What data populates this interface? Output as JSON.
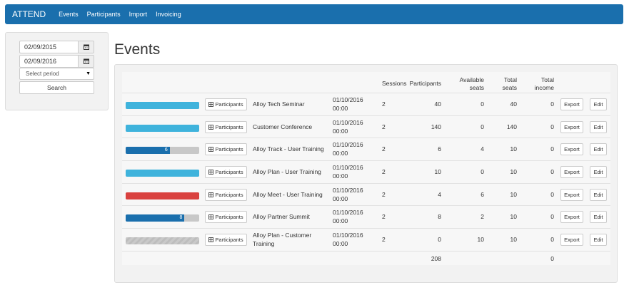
{
  "navbar": {
    "brand": "ATTEND",
    "links": [
      "Events",
      "Participants",
      "Import",
      "Invoicing"
    ]
  },
  "sidebar": {
    "date_from": "02/09/2015",
    "date_to": "02/09/2016",
    "period_placeholder": "Select period",
    "search_label": "Search"
  },
  "page": {
    "title": "Events"
  },
  "table": {
    "headers": {
      "sessions": "Sessions",
      "participants": "Participants",
      "available_line1": "Available",
      "available_line2": "seats",
      "total_line1": "Total",
      "total_line2": "seats",
      "income_line1": "Total",
      "income_line2": "income"
    },
    "participants_button": "Participants",
    "export_button": "Export",
    "edit_button": "Edit",
    "rows": [
      {
        "name": "Alloy Tech Seminar",
        "date": "01/10/2016",
        "time": "00:00",
        "sessions": "2",
        "participants": "40",
        "available": "0",
        "total": "40",
        "income": "0"
      },
      {
        "name": "Customer Conference",
        "date": "01/10/2016",
        "time": "00:00",
        "sessions": "2",
        "participants": "140",
        "available": "0",
        "total": "140",
        "income": "0"
      },
      {
        "name": "Alloy Track - User Training",
        "date": "01/10/2016",
        "time": "00:00",
        "sessions": "2",
        "participants": "6",
        "available": "4",
        "total": "10",
        "income": "0"
      },
      {
        "name": "Alloy Plan - User Training",
        "date": "01/10/2016",
        "time": "00:00",
        "sessions": "2",
        "participants": "10",
        "available": "0",
        "total": "10",
        "income": "0"
      },
      {
        "name": "Alloy Meet - User Training",
        "date": "01/10/2016",
        "time": "00:00",
        "sessions": "2",
        "participants": "4",
        "available": "6",
        "total": "10",
        "income": "0"
      },
      {
        "name": "Alloy Partner Summit",
        "date": "01/10/2016",
        "time": "00:00",
        "sessions": "2",
        "participants": "8",
        "available": "2",
        "total": "10",
        "income": "0"
      },
      {
        "name_line1": "Alloy Plan - Customer",
        "name_line2": "Training",
        "date": "01/10/2016",
        "time": "00:00",
        "sessions": "2",
        "participants": "0",
        "available": "10",
        "total": "10",
        "income": "0"
      }
    ],
    "totals": {
      "participants": "208",
      "income": "0"
    }
  },
  "bars": [
    {
      "fill": 1.0,
      "color": "#3fb3dc",
      "label": ""
    },
    {
      "fill": 1.0,
      "color": "#3fb3dc",
      "label": ""
    },
    {
      "fill": 0.6,
      "color": "#1a6fad",
      "label": "6"
    },
    {
      "fill": 1.0,
      "color": "#3fb3dc",
      "label": ""
    },
    {
      "fill": 1.0,
      "color": "#d9413f",
      "label": ""
    },
    {
      "fill": 0.8,
      "color": "#1a6fad",
      "label": "8"
    },
    {
      "fill": 0.0,
      "color": "#c8c8c8",
      "label": ""
    }
  ],
  "colors": {
    "navbar": "#1a6fad",
    "accent": "#3fb3dc",
    "danger": "#d9413f"
  },
  "icons": {
    "calendar": "calendar-icon",
    "participants": "list-icon"
  }
}
